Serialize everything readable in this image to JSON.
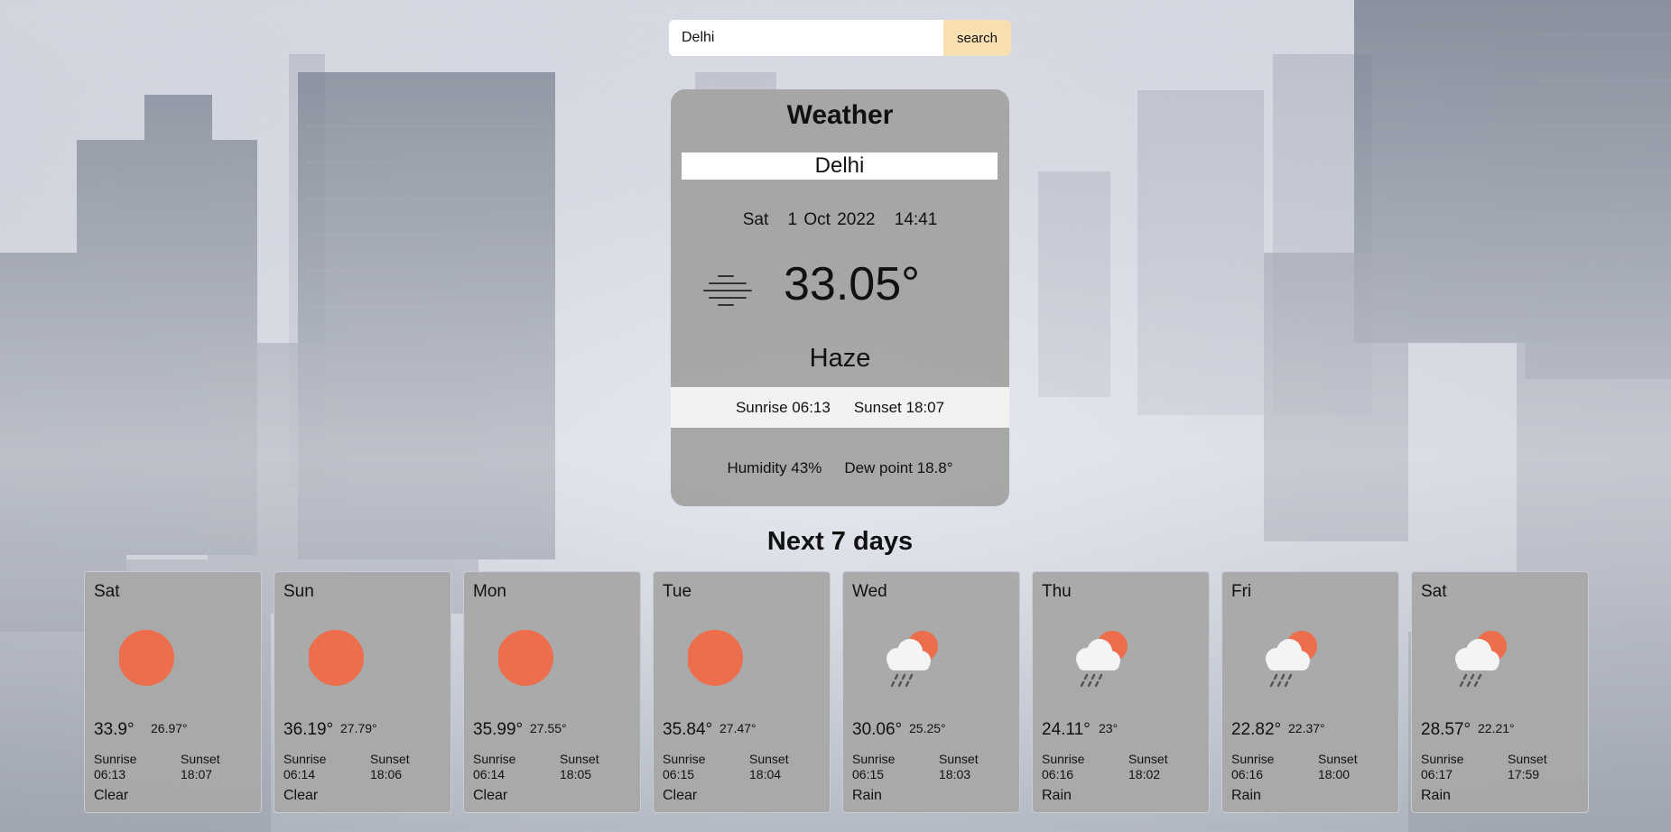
{
  "search": {
    "value": "Delhi",
    "button_label": "search"
  },
  "current": {
    "title": "Weather",
    "city": "Delhi",
    "day": "Sat",
    "date": "1 Oct 2022",
    "time": "14:41",
    "icon": "haze-icon",
    "temperature": "33.05°",
    "condition": "Haze",
    "sunrise": "Sunrise 06:13",
    "sunset": "Sunset 18:07",
    "humidity": "Humidity 43%",
    "dew_point": "Dew point 18.8°"
  },
  "forecast_title": "Next 7 days",
  "colors": {
    "sun": "#ec6e4c",
    "search_button": "#f7dfb1",
    "card": "#a4a4a4"
  },
  "forecast": [
    {
      "day": "Sat",
      "icon": "sun-icon",
      "high": "33.9°",
      "low": "26.97°",
      "sunrise_label": "Sunrise",
      "sunrise": "06:13",
      "sunset_label": "Sunset",
      "sunset": "18:07",
      "condition": "Clear"
    },
    {
      "day": "Sun",
      "icon": "sun-icon",
      "high": "36.19°",
      "low": "27.79°",
      "sunrise_label": "Sunrise",
      "sunrise": "06:14",
      "sunset_label": "Sunset",
      "sunset": "18:06",
      "condition": "Clear"
    },
    {
      "day": "Mon",
      "icon": "sun-icon",
      "high": "35.99°",
      "low": "27.55°",
      "sunrise_label": "Sunrise",
      "sunrise": "06:14",
      "sunset_label": "Sunset",
      "sunset": "18:05",
      "condition": "Clear"
    },
    {
      "day": "Tue",
      "icon": "sun-icon",
      "high": "35.84°",
      "low": "27.47°",
      "sunrise_label": "Sunrise",
      "sunrise": "06:15",
      "sunset_label": "Sunset",
      "sunset": "18:04",
      "condition": "Clear"
    },
    {
      "day": "Wed",
      "icon": "rain-cloud-sun-icon",
      "high": "30.06°",
      "low": "25.25°",
      "sunrise_label": "Sunrise",
      "sunrise": "06:15",
      "sunset_label": "Sunset",
      "sunset": "18:03",
      "condition": "Rain"
    },
    {
      "day": "Thu",
      "icon": "rain-cloud-sun-icon",
      "high": "24.11°",
      "low": "23°",
      "sunrise_label": "Sunrise",
      "sunrise": "06:16",
      "sunset_label": "Sunset",
      "sunset": "18:02",
      "condition": "Rain"
    },
    {
      "day": "Fri",
      "icon": "rain-cloud-sun-icon",
      "high": "22.82°",
      "low": "22.37°",
      "sunrise_label": "Sunrise",
      "sunrise": "06:16",
      "sunset_label": "Sunset",
      "sunset": "18:00",
      "condition": "Rain"
    },
    {
      "day": "Sat",
      "icon": "rain-cloud-sun-icon",
      "high": "28.57°",
      "low": "22.21°",
      "sunrise_label": "Sunrise",
      "sunrise": "06:17",
      "sunset_label": "Sunset",
      "sunset": "17:59",
      "condition": "Rain"
    }
  ]
}
